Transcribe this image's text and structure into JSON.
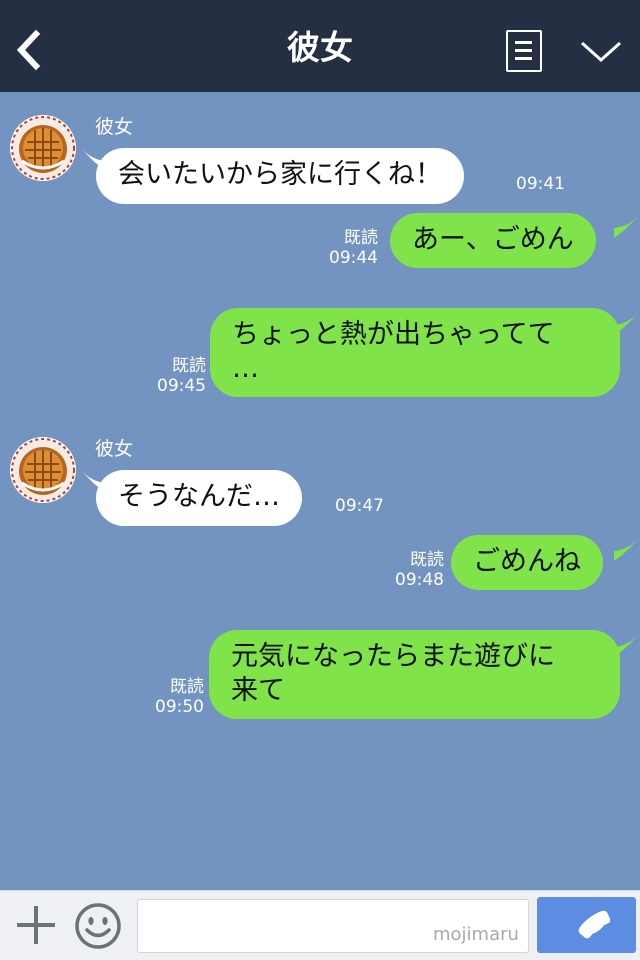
{
  "header": {
    "title": "彼女",
    "icons": [
      "chevron-left-icon",
      "memo-icon",
      "chevron-down-icon"
    ]
  },
  "colors": {
    "header_bg": "#252f44",
    "chat_bg": "#7393c1",
    "outgoing_bubble": "#80e34a",
    "incoming_bubble": "#ffffff",
    "call_button": "#5c8de2"
  },
  "messages": [
    {
      "direction": "in",
      "sender": "彼女",
      "lines": [
        "会いたいから家に行くね！"
      ],
      "time": "09:41"
    },
    {
      "direction": "out",
      "lines": [
        "あー、ごめん"
      ],
      "read_label": "既読",
      "time": "09:44"
    },
    {
      "direction": "out",
      "lines": [
        "ちょっと熱が出ちゃってて",
        "…"
      ],
      "read_label": "既読",
      "time": "09:45"
    },
    {
      "direction": "in",
      "sender": "彼女",
      "lines": [
        "そうなんだ…"
      ],
      "time": "09:47"
    },
    {
      "direction": "out",
      "lines": [
        "ごめんね"
      ],
      "read_label": "既読",
      "time": "09:48"
    },
    {
      "direction": "out",
      "lines": [
        "元気になったらまた遊びに",
        "来て"
      ],
      "read_label": "既読",
      "time": "09:50"
    }
  ],
  "input_bar": {
    "input_value": "",
    "watermark": "mojimaru",
    "icons": [
      "plus-icon",
      "smiley-icon",
      "phone-icon"
    ]
  }
}
